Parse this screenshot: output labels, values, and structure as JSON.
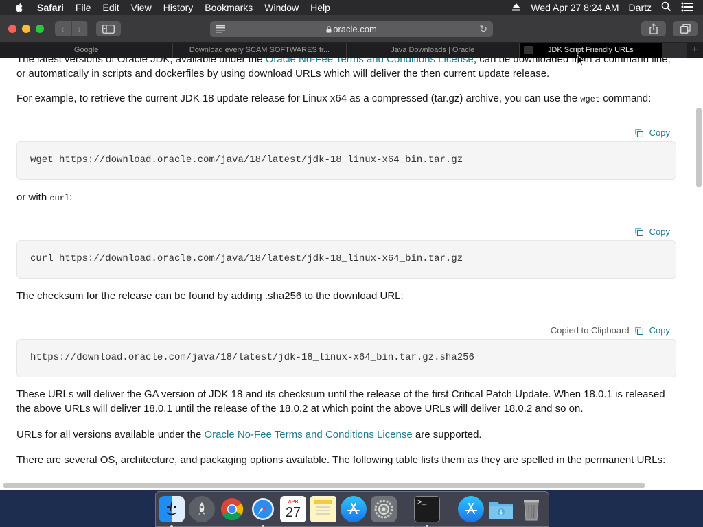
{
  "menubar": {
    "app": "Safari",
    "items": [
      "File",
      "Edit",
      "View",
      "History",
      "Bookmarks",
      "Window",
      "Help"
    ],
    "clock": "Wed Apr 27  8:24 AM",
    "user": "Dartz"
  },
  "toolbar": {
    "url": "oracle.com"
  },
  "tabs": [
    {
      "title": "Google",
      "active": false
    },
    {
      "title": "Download every SCAM SOFTWARES fr...",
      "active": false
    },
    {
      "title": "Java Downloads | Oracle",
      "active": false
    },
    {
      "title": "JDK Script Friendly URLs",
      "active": true
    }
  ],
  "page": {
    "intro_pre": "The latest versions of Oracle JDK, available under the ",
    "intro_link": "Oracle No-Fee Terms and Conditions License",
    "intro_post": ", can be downloaded from a command line,",
    "intro_line2": "or automatically in scripts and dockerfiles by using download URLs which will deliver the then current update release.",
    "example_pre": "For example, to retrieve the current JDK 18 update release for Linux x64 as a compressed (tar.gz) archive, you can use the ",
    "example_code": "wget",
    "example_post": " command:",
    "copy_label": "Copy",
    "copied_label": "Copied to Clipboard",
    "code1": "wget https://download.oracle.com/java/18/latest/jdk-18_linux-x64_bin.tar.gz",
    "with_pre": "or with ",
    "with_code": "curl",
    "with_post": ":",
    "code2": "curl https://download.oracle.com/java/18/latest/jdk-18_linux-x64_bin.tar.gz",
    "checksum_text": "The checksum for the release can be found by adding .sha256 to the download URL:",
    "code3": "https://download.oracle.com/java/18/latest/jdk-18_linux-x64_bin.tar.gz.sha256",
    "ga_line1": "These URLs will deliver the GA version of JDK 18 and its checksum until the release of the first Critical Patch Update. When 18.0.1 is released",
    "ga_line2": "the above URLs will deliver 18.0.1 until the release of the 18.0.2 at which point the above URLs will deliver 18.0.2 and so on.",
    "urls_pre": "URLs for all versions available under the ",
    "urls_link": "Oracle No-Fee Terms and Conditions License",
    "urls_post": " are supported.",
    "several_text": "There are several OS, architecture, and packaging options available. The following table lists them as they are spelled in the permanent URLs:"
  },
  "dock": {
    "calendar_month": "APR",
    "calendar_day": "27"
  },
  "colors": {
    "link": "#1d7a8c",
    "menubar": "#2a2a2c",
    "toolbar": "#3a3a3c"
  }
}
